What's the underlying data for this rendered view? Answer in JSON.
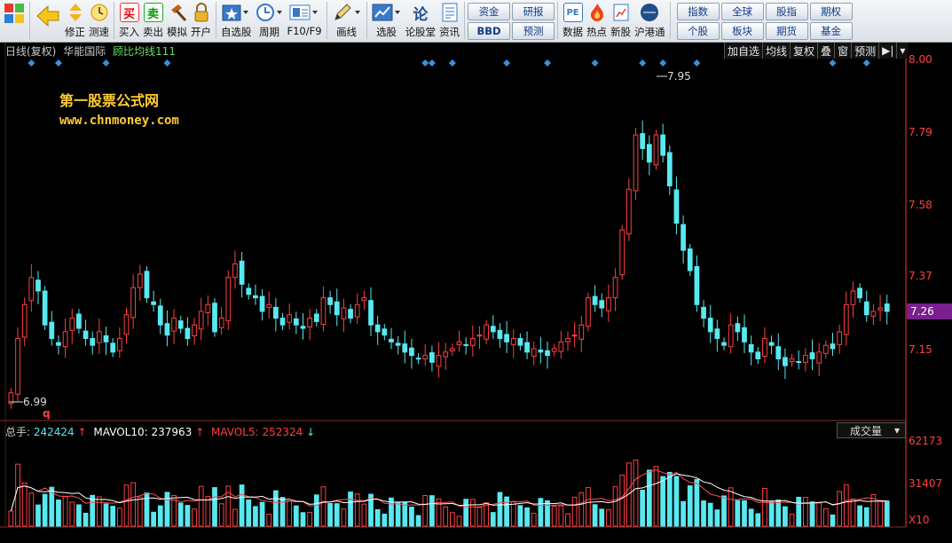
{
  "toolbar": {
    "items": [
      {
        "label": "修正",
        "icon": "arrow-up-down-icon"
      },
      {
        "label": "测速",
        "icon": "clock-icon"
      },
      {
        "label": "买入",
        "icon": "buy-icon",
        "glyph": "买"
      },
      {
        "label": "卖出",
        "icon": "sell-icon",
        "glyph": "卖"
      },
      {
        "label": "模拟",
        "icon": "hammer-icon"
      },
      {
        "label": "开户",
        "icon": "lock-icon"
      },
      {
        "label": "自选股",
        "icon": "star-folder-icon"
      },
      {
        "label": "周期",
        "icon": "period-icon"
      },
      {
        "label": "F10/F9",
        "icon": "f10-icon"
      },
      {
        "label": "画线",
        "icon": "pen-icon"
      },
      {
        "label": "选股",
        "icon": "stock-pick-icon"
      },
      {
        "label": "论股堂",
        "icon": "forum-icon",
        "glyph": "论"
      },
      {
        "label": "资讯",
        "icon": "news-icon"
      }
    ],
    "group1": [
      [
        "资金",
        "研报"
      ],
      [
        "BBD",
        "预测"
      ]
    ],
    "items2": [
      {
        "label": "数据",
        "icon": "pe-data-icon",
        "glyph": "PE"
      },
      {
        "label": "热点",
        "icon": "hot-icon"
      },
      {
        "label": "新股",
        "icon": "new-stock-icon"
      },
      {
        "label": "沪港通",
        "icon": "sse-hkex-icon"
      }
    ],
    "group2": [
      "指数",
      "全球",
      "股指",
      "期权",
      "个股",
      "板块",
      "期货",
      "基金"
    ]
  },
  "chart": {
    "title": "日线(复权)",
    "stock": "华能国际",
    "indicator": "顾比均线111",
    "watermark1": "第一股票公式网",
    "watermark2": "www.chnmoney.com",
    "buttons": [
      "加自选",
      "均线",
      "复权",
      "叠",
      "窗",
      "预测"
    ],
    "price_axis": [
      "8.00",
      "7.79",
      "7.58",
      "7.37",
      "7.26",
      "7.15"
    ],
    "current_price": "7.26",
    "high_label": "7.95",
    "low_label": "6.99",
    "low_marker": "q",
    "volume_header": {
      "label": "总手:",
      "value": "242424",
      "arrow1": "↑",
      "mavol10_label": "MAVOL10:",
      "mavol10": "237963",
      "arrow2": "↑",
      "mavol5_label": "MAVOL5:",
      "mavol5": "252324",
      "arrow3": "↓"
    },
    "volume_selector": "成交量",
    "volume_axis": [
      "62173",
      "31407",
      "X10"
    ],
    "colors": {
      "up": "#ff4040",
      "down": "#58e8f0",
      "axis": "#ff3030",
      "signal": "#3b8fd8"
    }
  },
  "chart_data": {
    "type": "candlestick",
    "price_range": [
      6.95,
      8.02
    ],
    "volume_range": [
      0,
      62173
    ],
    "signal_marker_count": 15
  }
}
